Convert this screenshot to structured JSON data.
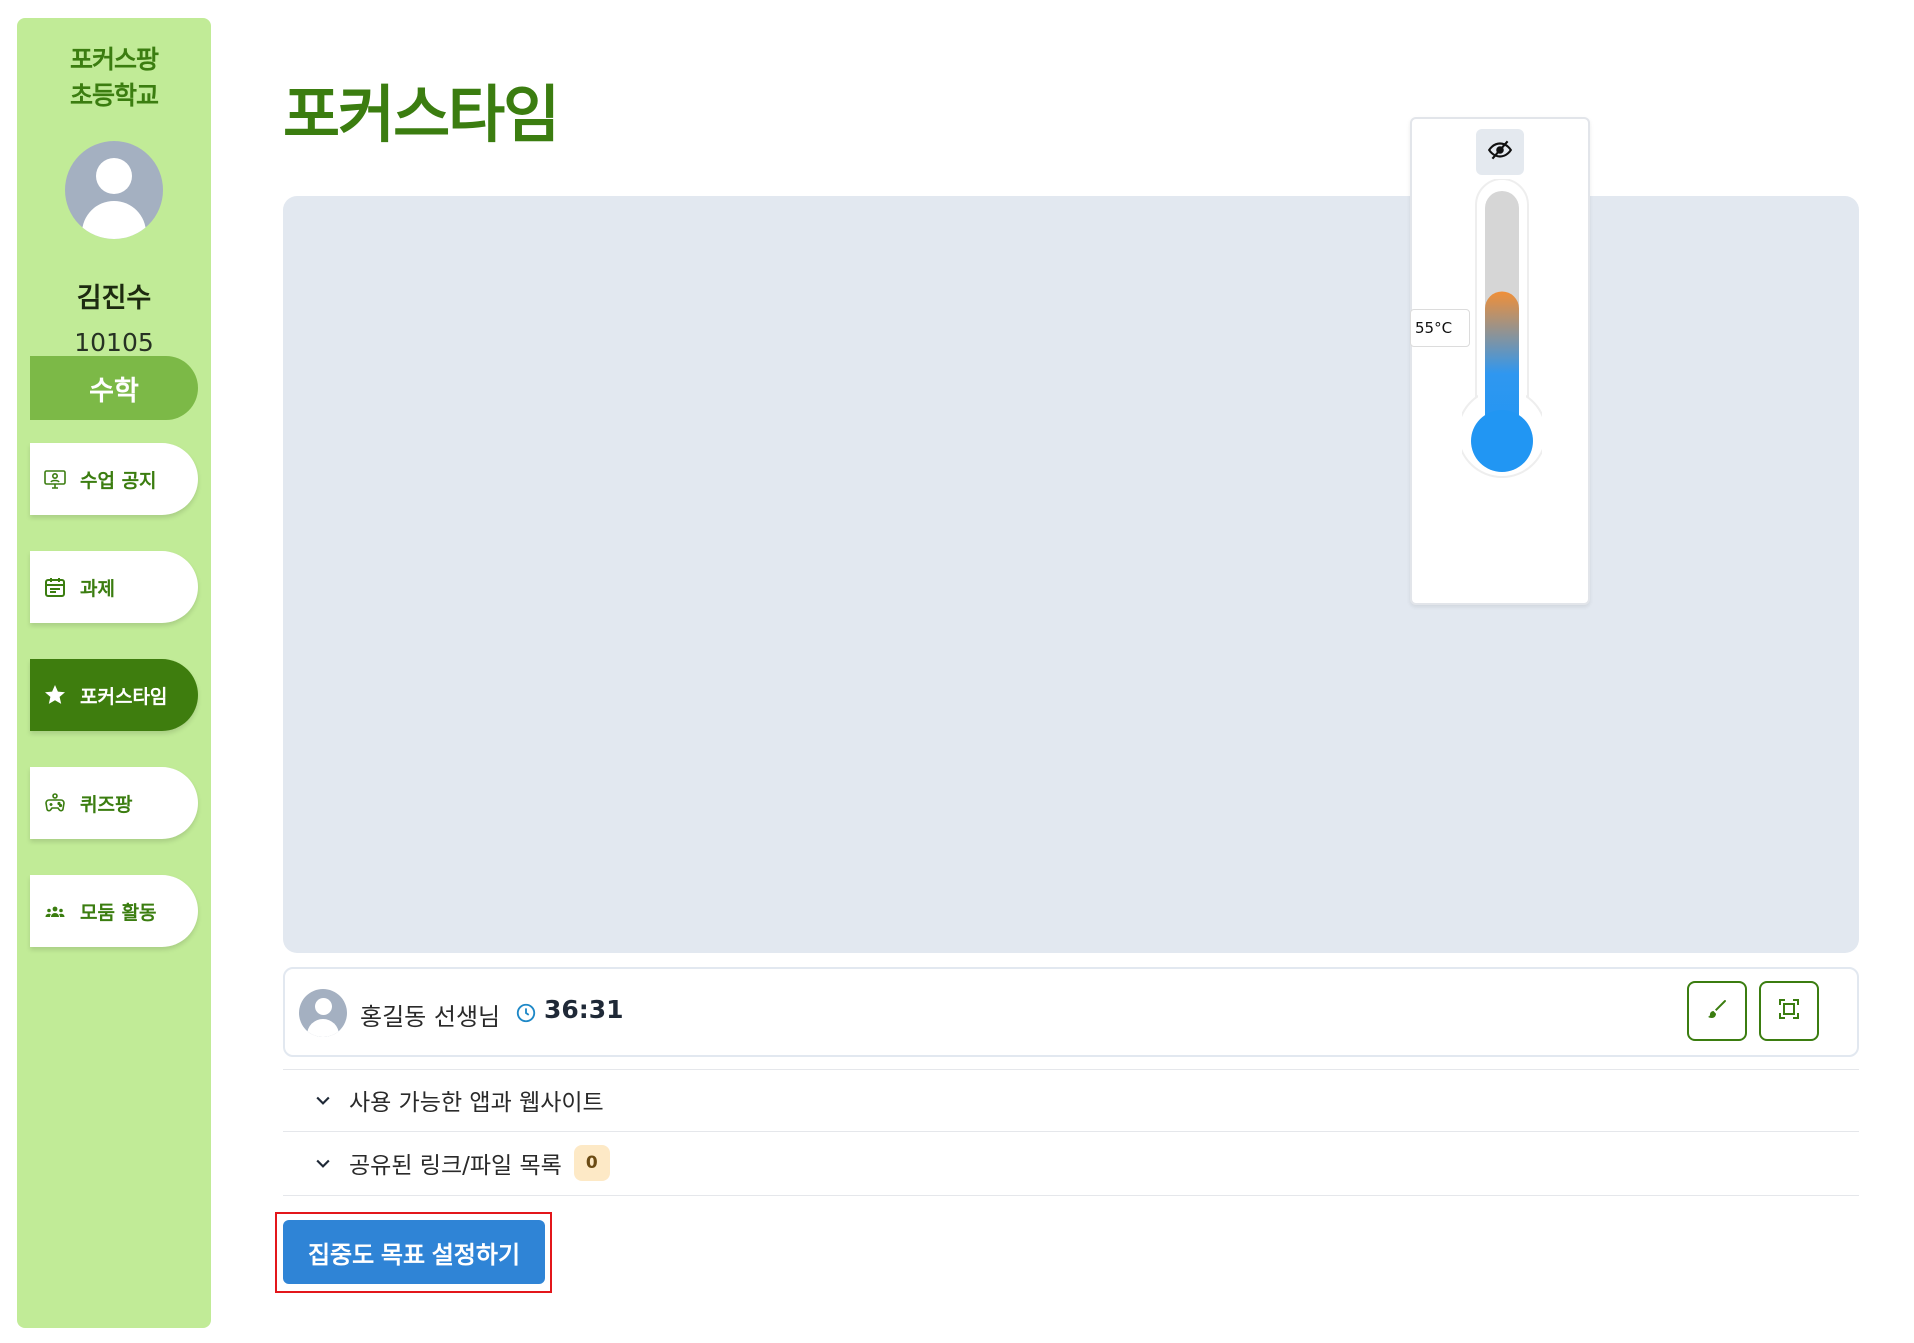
{
  "sidebar": {
    "school_line1": "포커스팡",
    "school_line2": "초등학교",
    "student_name": "김진수",
    "student_id": "10105",
    "subject": "수학",
    "items": [
      {
        "label": "수업 공지",
        "icon": "monitor-person-icon"
      },
      {
        "label": "과제",
        "icon": "calendar-icon"
      },
      {
        "label": "포커스타임",
        "icon": "star-icon",
        "active": true
      },
      {
        "label": "퀴즈팡",
        "icon": "gamepad-icon"
      },
      {
        "label": "모둠 활동",
        "icon": "group-icon"
      }
    ]
  },
  "main": {
    "title": "포커스타임",
    "thermometer": {
      "temperature_label": "55°C",
      "level_fraction": 0.55
    },
    "info_bar": {
      "teacher": "홍길동 선생님",
      "timer": "36:31"
    },
    "sections": [
      {
        "label": "사용 가능한 앱과 웹사이트"
      },
      {
        "label": "공유된 링크/파일 목록",
        "count": "0"
      }
    ],
    "goal_button": "집중도 목표 설정하기"
  },
  "colors": {
    "sidebar_bg": "#c1eb97",
    "brand_green": "#3b7d10",
    "subject_green": "#7cb947",
    "primary_blue": "#2f84d6",
    "video_bg": "#e2e8f0"
  }
}
